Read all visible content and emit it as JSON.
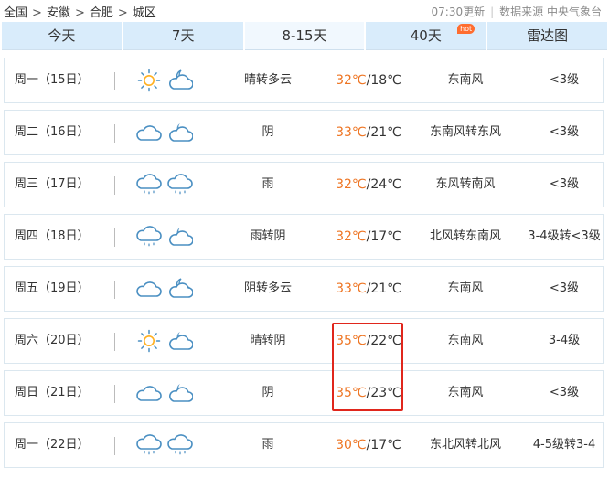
{
  "breadcrumb": {
    "items": [
      "全国",
      "安徽",
      "合肥",
      "城区"
    ],
    "separator": ">"
  },
  "header": {
    "update_time": "07:30更新",
    "source_label": "数据来源 中央气象台"
  },
  "tabs": [
    {
      "label": "今天",
      "active": false
    },
    {
      "label": "7天",
      "active": false
    },
    {
      "label": "8-15天",
      "active": true
    },
    {
      "label": "40天",
      "active": false,
      "badge": "hot"
    },
    {
      "label": "雷达图",
      "active": false
    }
  ],
  "colors": {
    "tab_bg": "#d9ecfb",
    "tab_active_bg": "#f1f8fe",
    "high_temp": "#ee7523",
    "highlight_border": "#e0261c",
    "icon_stroke": "#4a8fc2",
    "sun": "#ffb020"
  },
  "forecast": [
    {
      "day": "周一（15日）",
      "icons": [
        "sun-icon",
        "partly-cloudy-night-icon"
      ],
      "desc": "晴转多云",
      "high": "32℃",
      "low": "/18℃",
      "wind": "东南风",
      "level": "<3级"
    },
    {
      "day": "周二（16日）",
      "icons": [
        "cloud-icon",
        "cloudy-night-icon"
      ],
      "desc": "阴",
      "high": "33℃",
      "low": "/21℃",
      "wind": "东南风转东风",
      "level": "<3级"
    },
    {
      "day": "周三（17日）",
      "icons": [
        "rain-icon",
        "rain-icon"
      ],
      "desc": "雨",
      "high": "32℃",
      "low": "/24℃",
      "wind": "东风转南风",
      "level": "<3级"
    },
    {
      "day": "周四（18日）",
      "icons": [
        "rain-icon",
        "cloudy-night-icon"
      ],
      "desc": "雨转阴",
      "high": "32℃",
      "low": "/17℃",
      "wind": "北风转东南风",
      "level": "3-4级转<3级"
    },
    {
      "day": "周五（19日）",
      "icons": [
        "cloud-icon",
        "partly-cloudy-night-icon"
      ],
      "desc": "阴转多云",
      "high": "33℃",
      "low": "/21℃",
      "wind": "东南风",
      "level": "<3级"
    },
    {
      "day": "周六（20日）",
      "icons": [
        "sun-icon",
        "cloudy-night-icon"
      ],
      "desc": "晴转阴",
      "high": "35℃",
      "low": "/22℃",
      "wind": "东南风",
      "level": "3-4级"
    },
    {
      "day": "周日（21日）",
      "icons": [
        "cloud-icon",
        "cloudy-night-icon"
      ],
      "desc": "阴",
      "high": "35℃",
      "low": "/23℃",
      "wind": "东南风",
      "level": "<3级"
    },
    {
      "day": "周一（22日）",
      "icons": [
        "rain-icon",
        "rain-icon"
      ],
      "desc": "雨",
      "high": "30℃",
      "low": "/17℃",
      "wind": "东北风转北风",
      "level": "4-5级转3-4"
    }
  ]
}
